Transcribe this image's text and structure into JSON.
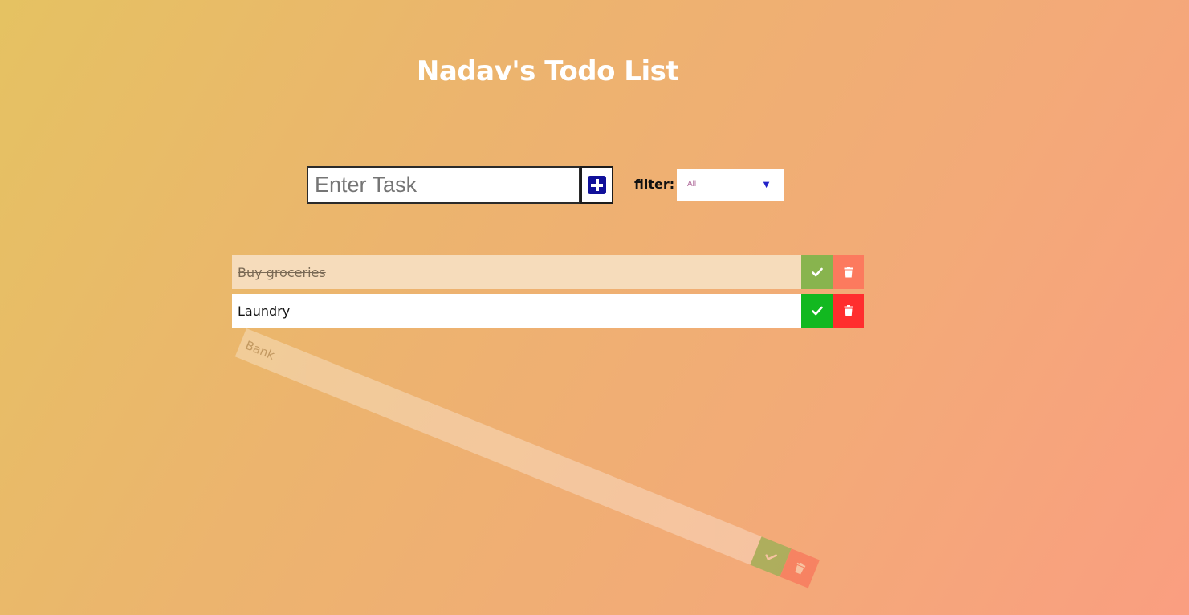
{
  "header": {
    "title": "Nadav's Todo List"
  },
  "input": {
    "placeholder": "Enter Task",
    "value": ""
  },
  "add_button": {
    "icon": "plus-square-icon"
  },
  "filter": {
    "label": "filter:",
    "selected": "All",
    "arrow": "▼"
  },
  "todos": [
    {
      "text": "Buy groceries",
      "state": "completed"
    },
    {
      "text": "Laundry",
      "state": "active"
    },
    {
      "text": "Bank",
      "state": "deleting"
    }
  ],
  "colors": {
    "check": "#12b820",
    "trash": "#ff2e2e",
    "add_icon": "#10109a",
    "filter_arrow": "#2323c8"
  }
}
